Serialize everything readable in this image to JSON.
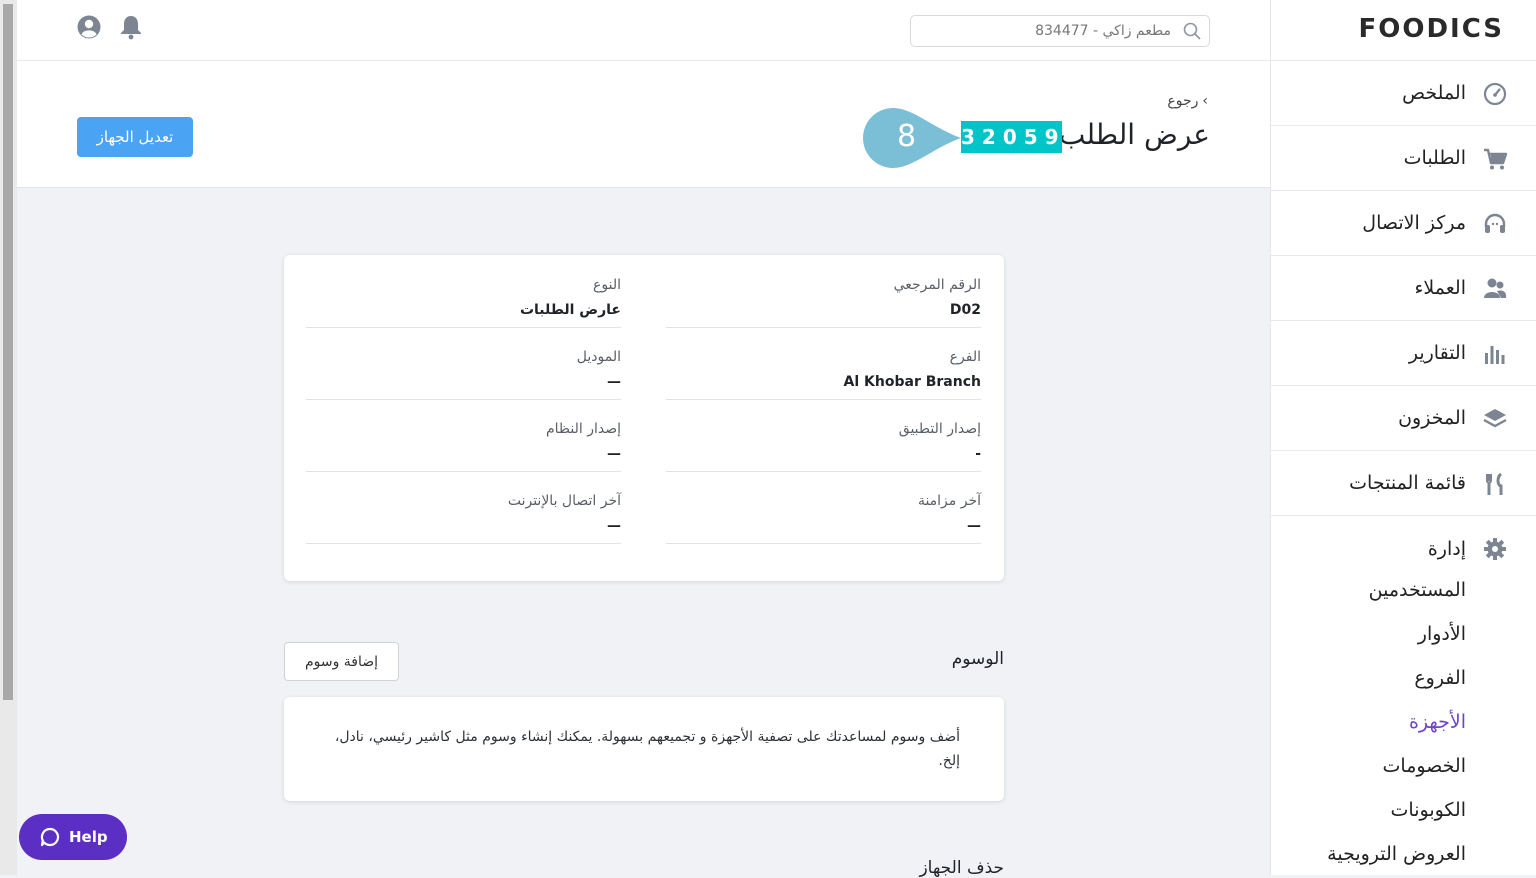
{
  "sidebar": {
    "logo": "FOODICS",
    "items": [
      {
        "label": "الملخص",
        "icon": "dashboard-icon"
      },
      {
        "label": "الطلبات",
        "icon": "cart-icon"
      },
      {
        "label": "مركز الاتصال",
        "icon": "headset-icon"
      },
      {
        "label": "العملاء",
        "icon": "customers-icon"
      },
      {
        "label": "التقارير",
        "icon": "reports-icon"
      },
      {
        "label": "المخزون",
        "icon": "inventory-icon"
      },
      {
        "label": "قائمة المنتجات",
        "icon": "menu-icon"
      }
    ],
    "admin": {
      "label": "إدارة",
      "icon": "gear-icon",
      "items": [
        {
          "label": "المستخدمين"
        },
        {
          "label": "الأدوار"
        },
        {
          "label": "الفروع"
        },
        {
          "label": "الأجهزة",
          "active": true
        },
        {
          "label": "الخصومات"
        },
        {
          "label": "الكوبونات"
        },
        {
          "label": "العروض الترويجية"
        }
      ]
    },
    "active_color": "#6e44c9"
  },
  "header": {
    "search_placeholder": "مطعم زاكي - 834477"
  },
  "page": {
    "back_label": "رجوع",
    "title": "عرض الطلب",
    "order_number": "32059",
    "step_marker": "8",
    "edit_button": "تعديل الجهاز"
  },
  "details": {
    "reference_label": "الرقم المرجعي",
    "reference_value": "D02",
    "type_label": "النوع",
    "type_value": "عارض الطلبات",
    "branch_label": "الفرع",
    "branch_value": "Al Khobar Branch",
    "model_label": "الموديل",
    "model_value": "—",
    "app_version_label": "إصدار التطبيق",
    "app_version_value": "-",
    "os_version_label": "إصدار النظام",
    "os_version_value": "—",
    "last_sync_label": "آخر مزامنة",
    "last_sync_value": "—",
    "last_online_label": "آخر اتصال بالإنترنت",
    "last_online_value": "—"
  },
  "tags": {
    "title": "الوسوم",
    "add_button": "إضافة وسوم",
    "description": "أضف وسوم لمساعدتك على تصفية الأجهزة و تجميعهم بسهولة. يمكنك إنشاء وسوم مثل كاشير رئيسي، نادل، إلخ."
  },
  "delete_section": {
    "title": "حذف الجهاز"
  },
  "help": {
    "label": "Help"
  },
  "colors": {
    "badge": "#00c5c8",
    "primary_button": "#4aa3f3",
    "help_button": "#5b2ec4",
    "step_marker": "#7bbfd6"
  }
}
